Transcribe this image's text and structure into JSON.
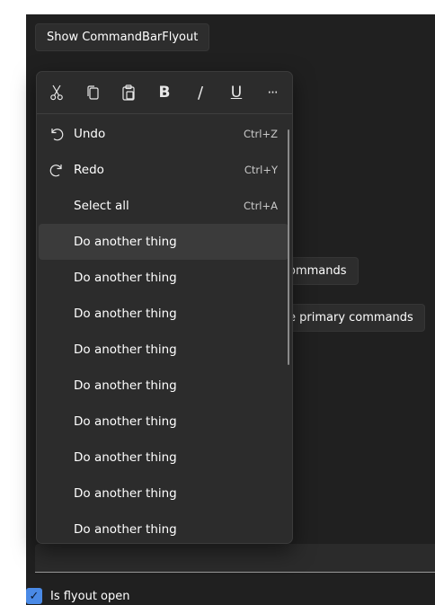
{
  "show_button_label": "Show CommandBarFlyout",
  "behind_buttons": [
    "ommands",
    "e primary commands"
  ],
  "primary_commands": [
    {
      "name": "cut",
      "icon": "scissors-icon"
    },
    {
      "name": "copy",
      "icon": "copy-icon"
    },
    {
      "name": "paste",
      "icon": "paste-icon"
    },
    {
      "name": "bold",
      "icon": "bold-icon",
      "glyph": "B"
    },
    {
      "name": "italic",
      "icon": "italic-icon",
      "glyph": "/"
    },
    {
      "name": "underline",
      "icon": "underline-icon",
      "glyph": "U"
    },
    {
      "name": "more",
      "icon": "more-icon",
      "glyph": "···"
    }
  ],
  "menu_items": [
    {
      "label": "Undo",
      "accelerator": "Ctrl+Z",
      "icon": "undo-icon"
    },
    {
      "label": "Redo",
      "accelerator": "Ctrl+Y",
      "icon": "redo-icon"
    },
    {
      "label": "Select all",
      "accelerator": "Ctrl+A"
    },
    {
      "label": "Do another thing",
      "hover": true
    },
    {
      "label": "Do another thing"
    },
    {
      "label": "Do another thing"
    },
    {
      "label": "Do another thing"
    },
    {
      "label": "Do another thing"
    },
    {
      "label": "Do another thing"
    },
    {
      "label": "Do another thing"
    },
    {
      "label": "Do another thing"
    },
    {
      "label": "Do another thing"
    }
  ],
  "checkbox": {
    "label": "Is flyout open",
    "checked": true,
    "glyph": "✓"
  },
  "colors": {
    "app_bg": "#202020",
    "flyout_bg": "#2c2c2c",
    "accent": "#4a8ae6",
    "hover": "#3b3b3b"
  }
}
